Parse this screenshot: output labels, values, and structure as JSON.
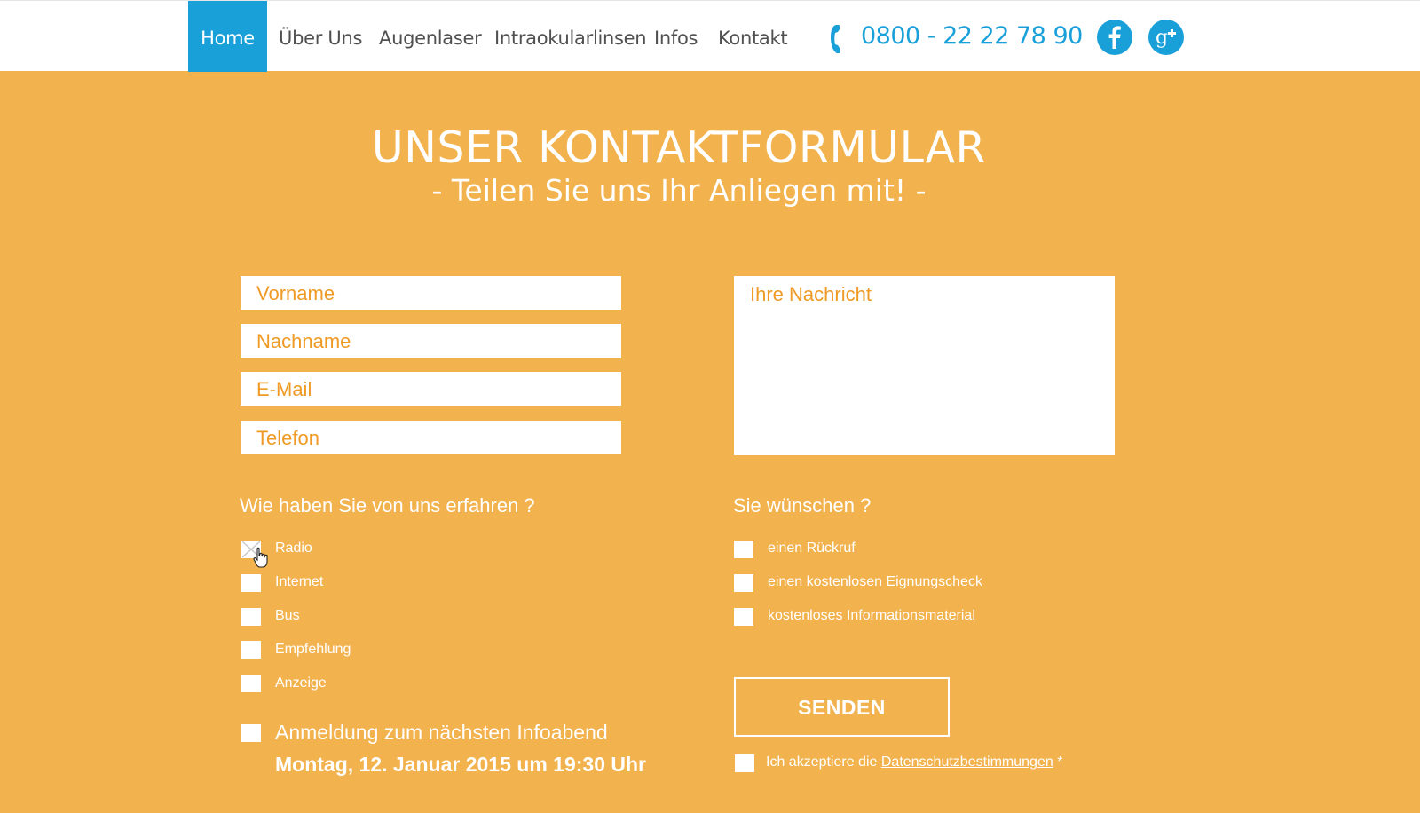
{
  "nav": {
    "items": [
      {
        "label": "Home",
        "active": true
      },
      {
        "label": "Über Uns"
      },
      {
        "label": "Augenlaser"
      },
      {
        "label": "Intraokularlinsen"
      },
      {
        "label": "Infos"
      },
      {
        "label": "Kontakt"
      }
    ],
    "phone": "0800 - 22 22 78 90",
    "social": [
      "facebook-icon",
      "google-plus-icon"
    ]
  },
  "heading": {
    "title": "UNSER KONTAKTFORMULAR",
    "subtitle": "- Teilen Sie uns Ihr Anliegen mit! -"
  },
  "form": {
    "fields": [
      {
        "placeholder": "Vorname"
      },
      {
        "placeholder": "Nachname"
      },
      {
        "placeholder": "E-Mail"
      },
      {
        "placeholder": "Telefon"
      }
    ],
    "message_placeholder": "Ihre Nachricht",
    "source": {
      "label": "Wie haben Sie von uns erfahren ?",
      "options": [
        {
          "label": "Radio",
          "checked": true
        },
        {
          "label": "Internet",
          "checked": false
        },
        {
          "label": "Bus",
          "checked": false
        },
        {
          "label": "Empfehlung",
          "checked": false
        },
        {
          "label": "Anzeige",
          "checked": false
        }
      ]
    },
    "wishes": {
      "label": "Sie wünschen ?",
      "options": [
        {
          "label": "einen Rückruf",
          "checked": false
        },
        {
          "label": "einen kostenlosen Eignungscheck",
          "checked": false
        },
        {
          "label": "kostenloses Informationsmaterial",
          "checked": false
        }
      ]
    },
    "infoabend": {
      "label": "Anmeldung zum nächsten Infoabend",
      "date": "Montag, 12. Januar 2015 um 19:30 Uhr"
    },
    "send_label": "SENDEN",
    "privacy": {
      "prefix": "Ich akzeptiere die",
      "link": "Datenschutzbestimmungen",
      "suffix": "*"
    }
  },
  "colors": {
    "background": "#f2b24e",
    "accent": "#1aa0d9",
    "placeholder": "#ef9a24"
  }
}
